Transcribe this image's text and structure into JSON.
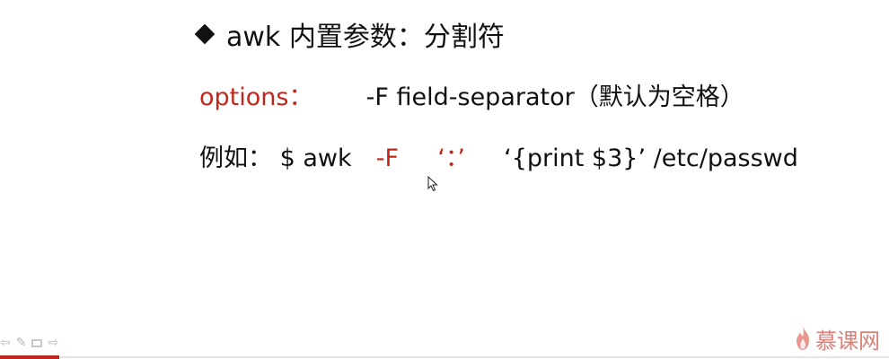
{
  "slide": {
    "title": "awk 内置参数：分割符",
    "options_label": "options：",
    "options_text": "-F  field-separator（默认为空格）",
    "example_label": "例如： $ awk",
    "example_flag": "-F",
    "example_sep": "‘：’",
    "example_rest": "‘{print $3}’   /etc/passwd"
  },
  "toolbar": {
    "icons": [
      "arrow-left-icon",
      "pen-icon",
      "box-icon",
      "arrow-right-icon"
    ]
  },
  "logo": {
    "text": "慕课网"
  },
  "colors": {
    "accent_red": "#c0271c",
    "logo": "#d86a60"
  }
}
